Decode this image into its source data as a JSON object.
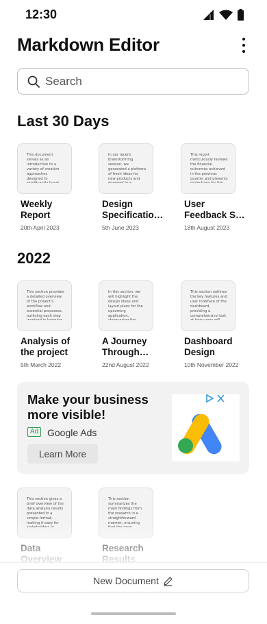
{
  "status_bar": {
    "time": "12:30",
    "icons": [
      "signal-icon",
      "wifi-icon",
      "battery-icon"
    ]
  },
  "header": {
    "title": "Markdown Editor",
    "menu_icon": "more-vert-icon"
  },
  "search": {
    "placeholder": "Search",
    "value": ""
  },
  "sections": [
    {
      "title": "Last 30 Days",
      "documents": [
        {
          "preview": "This document serves as an introduction to a variety of creative approaches designed to significantly boost brand awareness and...",
          "title": "Weekly Report",
          "date": "20th April 2023"
        },
        {
          "preview": "In our recent brainstorming session, we generated a plethora of fresh ideas for new products and engaged in a thorough discussi...",
          "title": "Design Specificatio…",
          "date": "5th June 2023"
        },
        {
          "preview": "This report meticulously reviews the financial outcomes achieved in the previous quarter and presents projections for the upc...",
          "title": "User Feedback S…",
          "date": "18th August 2023"
        }
      ]
    },
    {
      "title": "2022",
      "documents": [
        {
          "preview": "This section provides a detailed overview of the project's workflow and essential processes, outlining each step involved in bringing ou...",
          "title": "Analysis of the project",
          "date": "5th March 2022"
        },
        {
          "preview": "In this section, we will highlight the design ideas and layout plans for the upcoming application, showcasing the creative concepts t...",
          "title": "A Journey Through the…",
          "date": "22nd August 2022"
        },
        {
          "preview": "This section outlines the key features and user interface of the dashboard, providing a comprehensive look at how users will interact...",
          "title": "Dashboard Design",
          "date": "10th November 2022"
        },
        {
          "preview": "This section gives a brief overview of the data analysis results presented in a simple format, making it easy for stakeholders to gra...",
          "title": "Data Overview",
          "date": ""
        },
        {
          "preview": "This section summarizes the main findings from the research in a straightforward manner, ensuring that the insig...",
          "title": "Research Results",
          "date": ""
        }
      ]
    }
  ],
  "ad": {
    "headline": "Make your business more visible!",
    "badge": "Ad",
    "brand": "Google Ads",
    "cta": "Learn More",
    "logo": "google-ads-logo",
    "choices_icons": [
      "adchoices-icon",
      "close-icon"
    ],
    "colors": {
      "blue": "#4285F4",
      "yellow": "#FBBC04",
      "green": "#34A853",
      "badge_green": "#2E9B4D"
    }
  },
  "footer": {
    "new_document_label": "New Document",
    "new_document_icon": "pencil-icon"
  }
}
